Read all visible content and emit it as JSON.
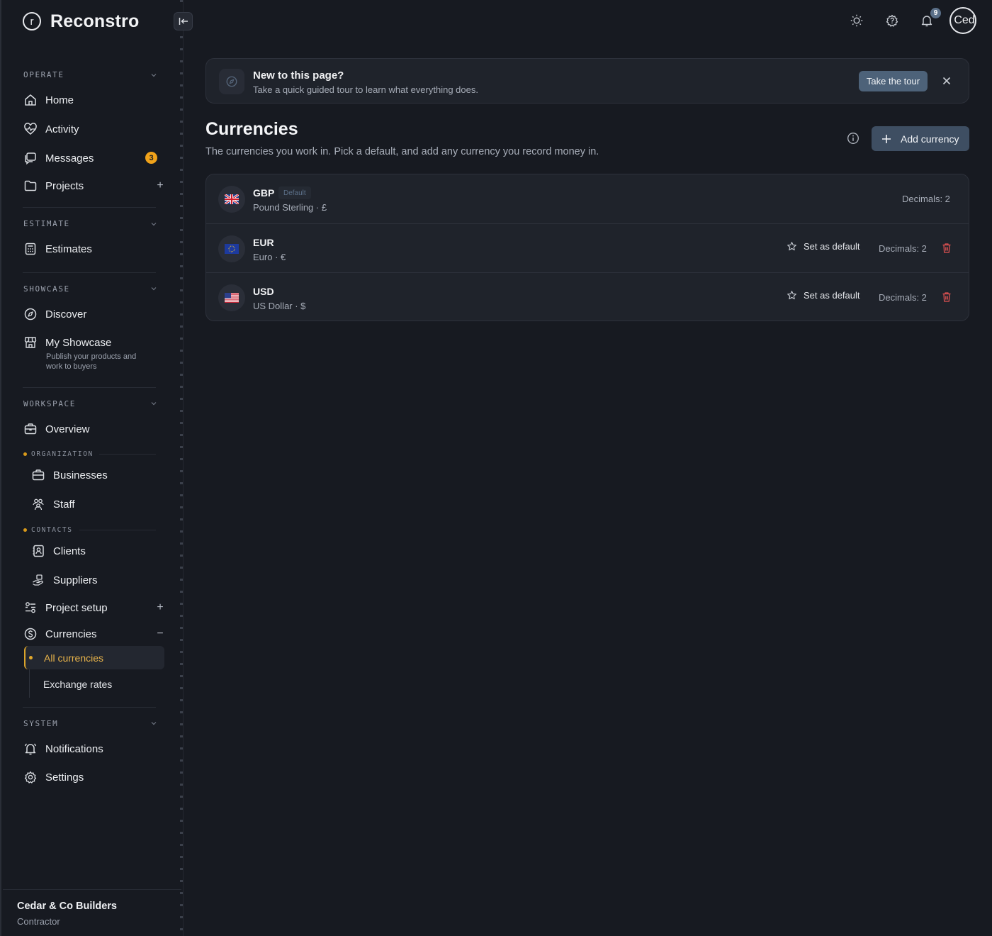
{
  "app": {
    "name": "Reconstro"
  },
  "sidebar": {
    "sections": {
      "operate": "OPERATE",
      "estimate": "ESTIMATE",
      "showcase": "SHOWCASE",
      "workspace": "WORKSPACE",
      "system": "SYSTEM"
    },
    "groups": {
      "organization": "ORGANIZATION",
      "contacts": "CONTACTS"
    },
    "items": {
      "home": "Home",
      "activity": "Activity",
      "messages": "Messages",
      "messages_badge": "3",
      "projects": "Projects",
      "estimates": "Estimates",
      "discover": "Discover",
      "my_showcase": "My Showcase",
      "my_showcase_sub": "Publish your products and work to buyers",
      "overview": "Overview",
      "businesses": "Businesses",
      "staff": "Staff",
      "clients": "Clients",
      "suppliers": "Suppliers",
      "project_setup": "Project setup",
      "currencies": "Currencies",
      "all_currencies": "All currencies",
      "exchange_rates": "Exchange rates",
      "notifications": "Notifications",
      "settings": "Settings"
    },
    "footer": {
      "company": "Cedar & Co Builders",
      "role": "Contractor"
    }
  },
  "topbar": {
    "notifications_count": "9",
    "avatar_text": "Ced",
    "icons": [
      "sun-icon",
      "help-icon",
      "bell-icon"
    ]
  },
  "tour": {
    "title": "New to this page?",
    "subtitle": "Take a quick guided tour to learn what everything does.",
    "button": "Take the tour"
  },
  "page": {
    "title": "Currencies",
    "subtitle": "The currencies you work in. Pick a default, and add any currency you record money in.",
    "add_button": "Add currency"
  },
  "currencies": [
    {
      "code": "GBP",
      "name": "Pound Sterling · £",
      "is_default": true,
      "default_label": "Default",
      "decimals": "Decimals: 2"
    },
    {
      "code": "EUR",
      "name": "Euro · €",
      "is_default": false,
      "set_default_label": "Set as default",
      "decimals": "Decimals: 2"
    },
    {
      "code": "USD",
      "name": "US Dollar · $",
      "is_default": false,
      "set_default_label": "Set as default",
      "decimals": "Decimals: 2"
    }
  ],
  "colors": {
    "background": "#171a21",
    "card": "#1f232b",
    "accent": "#e6b24a",
    "badge": "#f0a21a",
    "primary_button": "#3e4e62",
    "danger": "#e05252"
  }
}
